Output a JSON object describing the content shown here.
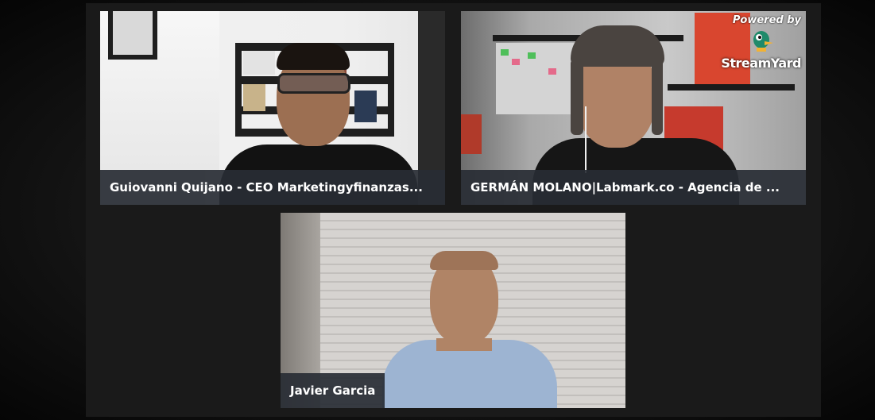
{
  "participants": [
    {
      "name": "Guiovanni Quijano - CEO Marketingyfinanzas..."
    },
    {
      "name": "GERMÁN MOLANO|Labmark.co - Agencia de ..."
    },
    {
      "name": "Javier Garcia"
    }
  ],
  "branding": {
    "powered_by": "Powered by",
    "brand_name": "StreamYard",
    "icon": "streamyard-duck-icon"
  },
  "colors": {
    "nameplate_bg": "#282c34",
    "nameplate_text": "#ffffff",
    "background": "#1a1a1a"
  }
}
